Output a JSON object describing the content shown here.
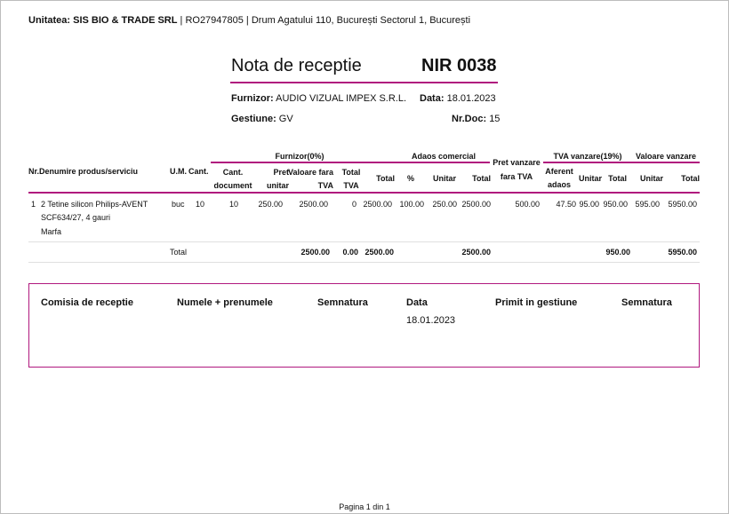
{
  "header": {
    "unitatea_label": "Unitatea: SIS BIO & TRADE SRL",
    "unitatea_rest": " | RO27947805 | Drum Agatului 110, București Sectorul 1, București"
  },
  "doc": {
    "title": "Nota de receptie",
    "number": "NIR 0038",
    "furnizor_label": "Furnizor:",
    "furnizor_value": "AUDIO VIZUAL IMPEX S.R.L.",
    "data_label": "Data:",
    "data_value": "18.01.2023",
    "gestiune_label": "Gestiune:",
    "gestiune_value": "GV",
    "nrdoc_label": "Nr.Doc:",
    "nrdoc_value": "15"
  },
  "table": {
    "groups": {
      "furnizor": "Furnizor(0%)",
      "adaos": "Adaos comercial",
      "pret_vanzare": "Pret vanzare",
      "tva_vanzare": "TVA vanzare(19%)",
      "valoare_vanzare": "Valoare vanzare"
    },
    "headers": {
      "nr_denumire": "Nr.Denumire produs/serviciu",
      "um": "U.M.",
      "cant": "Cant.",
      "cant_doc_1": "Cant.",
      "cant_doc_2": "document",
      "pret_unitar_1": "Pret",
      "pret_unitar_2": "unitar",
      "valoare_fara_1": "Valoare fara",
      "valoare_fara_2": "TVA",
      "total_tva_1": "Total",
      "total_tva_2": "TVA",
      "total": "Total",
      "pct": "%",
      "adaos_unitar": "Unitar",
      "adaos_total": "Total",
      "pret_fara_tva": "fara TVA",
      "aferent_1": "Aferent",
      "aferent_2": "adaos",
      "tva_unitar": "Unitar",
      "tva_total": "Total",
      "val_unitar": "Unitar",
      "val_total": "Total"
    },
    "rows": [
      {
        "nr": "1",
        "name_line1": "2 Tetine silicon Philips-AVENT",
        "name_line2": "SCF634/27, 4 gauri",
        "name_line3": "Marfa",
        "um": "buc",
        "cant": "10",
        "cant_doc": "10",
        "pret_unitar": "250.00",
        "valoare_fara_tva": "2500.00",
        "total_tva": "0",
        "total": "2500.00",
        "pct": "100.00",
        "adaos_unitar": "250.00",
        "adaos_total": "2500.00",
        "pret_fara_tva": "500.00",
        "aferent_adaos": "47.50",
        "tva_unitar": "95.00",
        "tva_total": "950.00",
        "val_unitar": "595.00",
        "val_total": "5950.00"
      }
    ],
    "totals": {
      "label": "Total",
      "valoare_fara_tva": "2500.00",
      "total_tva": "0.00",
      "total": "2500.00",
      "adaos_total": "2500.00",
      "tva_total": "950.00",
      "val_total": "5950.00"
    }
  },
  "comisia": {
    "col1": "Comisia de receptie",
    "col2": "Numele + prenumele",
    "col3": "Semnatura",
    "col4": "Data",
    "col4_value": "18.01.2023",
    "col5": "Primit in gestiune",
    "col6": "Semnatura"
  },
  "footer": {
    "page": "Pagina 1 din 1"
  }
}
